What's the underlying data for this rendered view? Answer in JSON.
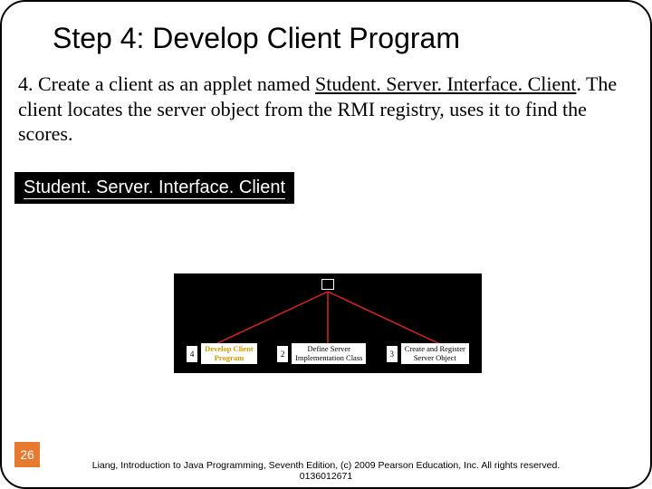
{
  "title": "Step 4: Develop Client Program",
  "body": {
    "lead": "4.  Create a client as an applet named ",
    "applet_name": "Student. Server. Interface. Client",
    "tail": ". The client locates the server object from the RMI registry, uses it to find the scores."
  },
  "label_box": "Student. Server. Interface. Client",
  "diagram": {
    "items": [
      {
        "num": "4",
        "label": "Develop Client\nProgram",
        "highlight": true
      },
      {
        "num": "2",
        "label": "Define Server\nImplementation Class",
        "highlight": false
      },
      {
        "num": "3",
        "label": "Create and Register\nServer Object",
        "highlight": false
      }
    ]
  },
  "page_number": "26",
  "footer": "Liang, Introduction to Java Programming, Seventh Edition, (c) 2009 Pearson Education, Inc. All rights reserved. 0136012671"
}
